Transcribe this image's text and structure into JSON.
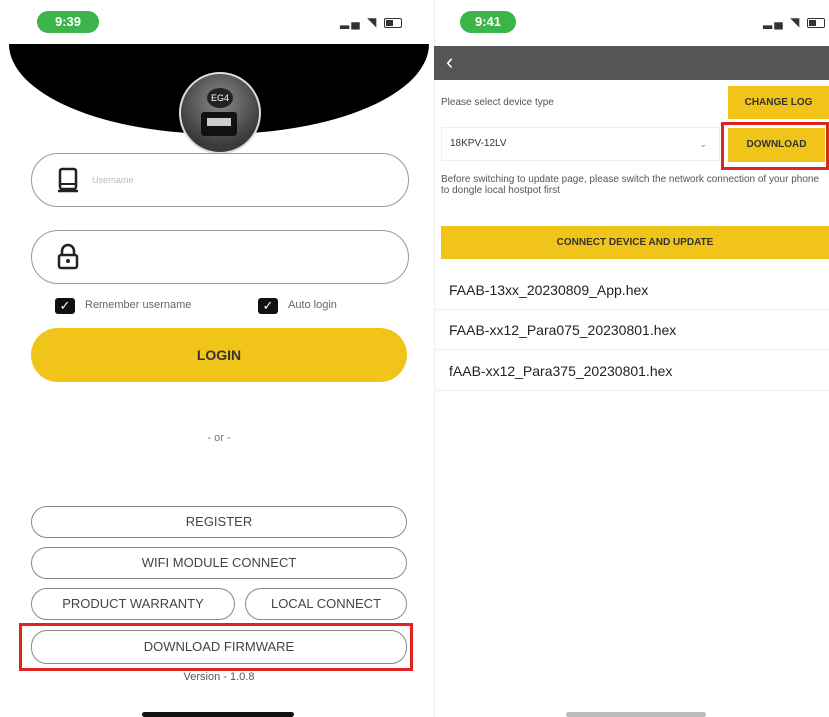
{
  "left": {
    "status_time": "9:39",
    "username_placeholder": "Username",
    "remember_label": "Remember username",
    "auto_login_label": "Auto login",
    "login_label": "LOGIN",
    "or_text": "- or -",
    "register_label": "REGISTER",
    "wifi_label": "WIFI MODULE CONNECT",
    "warranty_label": "PRODUCT WARRANTY",
    "local_label": "LOCAL CONNECT",
    "download_firmware_label": "DOWNLOAD FIRMWARE",
    "version_text": "Version - 1.0.8",
    "logo_text": "EG4"
  },
  "right": {
    "status_time": "9:41",
    "select_device_label": "Please select device type",
    "change_log_label": "CHANGE LOG",
    "device_value": "18KPV-12LV",
    "download_label": "DOWNLOAD",
    "note_text": "Before switching to update page, please switch the network connection of your phone to dongle local hostpot first",
    "connect_update_label": "CONNECT DEVICE AND UPDATE",
    "files": [
      "FAAB-13xx_20230809_App.hex",
      "FAAB-xx12_Para075_20230801.hex",
      "fAAB-xx12_Para375_20230801.hex"
    ]
  },
  "colors": {
    "accent_yellow": "#f0c419",
    "highlight_red": "#e0241f",
    "status_green": "#3bb54a"
  }
}
